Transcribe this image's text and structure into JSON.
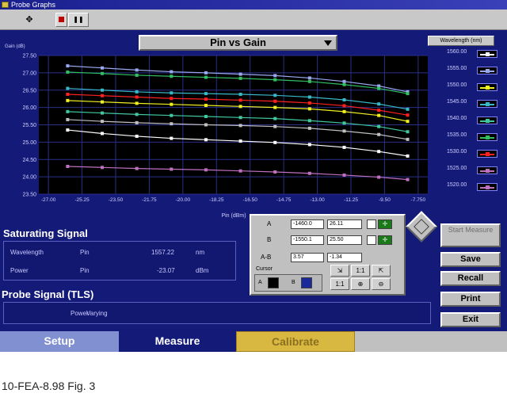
{
  "window": {
    "title": "Probe Graphs"
  },
  "toolbar": {
    "arrow_glyph": "✥",
    "pause_glyph": "❚❚"
  },
  "graph_selector": {
    "selected": "Pin vs Gain"
  },
  "wavelength_button": {
    "label": "Wavelength (nm)"
  },
  "chart_data": {
    "type": "line",
    "ylabel": "Gain (dB)",
    "xlabel": "Pin (dBm)",
    "xlim": [
      -27.5,
      -7.25
    ],
    "ylim": [
      23.5,
      27.5
    ],
    "y_ticks": [
      "27.50",
      "27.00",
      "26.50",
      "26.00",
      "25.50",
      "25.00",
      "24.50",
      "24.00",
      "23.50"
    ],
    "x_ticks": [
      "-27.00",
      "-25.25",
      "-23.50",
      "-21.75",
      "-20.00",
      "-18.25",
      "-16.50",
      "-14.75",
      "-13.00",
      "-11.25",
      "-9.50",
      "-7.750"
    ],
    "x": [
      -26.0,
      -24.2,
      -22.4,
      -20.6,
      -18.8,
      -17.0,
      -15.2,
      -13.4,
      -11.6,
      -9.8,
      -8.3
    ],
    "series": [
      {
        "color": "#9aa8f0",
        "values": [
          27.2,
          27.14,
          27.08,
          27.03,
          27.0,
          26.96,
          26.92,
          26.85,
          26.75,
          26.62,
          26.45
        ]
      },
      {
        "color": "#30c060",
        "values": [
          27.02,
          26.98,
          26.93,
          26.9,
          26.87,
          26.84,
          26.8,
          26.75,
          26.66,
          26.55,
          26.4
        ]
      },
      {
        "color": "#38b8c8",
        "values": [
          26.55,
          26.5,
          26.45,
          26.42,
          26.4,
          26.38,
          26.35,
          26.3,
          26.22,
          26.1,
          25.95
        ]
      },
      {
        "color": "#ff2020",
        "values": [
          26.38,
          26.34,
          26.3,
          26.26,
          26.24,
          26.21,
          26.18,
          26.13,
          26.05,
          25.92,
          25.78
        ]
      },
      {
        "color": "#f0f020",
        "values": [
          26.2,
          26.16,
          26.12,
          26.09,
          26.06,
          26.03,
          26.0,
          25.96,
          25.88,
          25.77,
          25.6
        ]
      },
      {
        "color": "#40c8a0",
        "values": [
          25.88,
          25.84,
          25.8,
          25.77,
          25.74,
          25.71,
          25.68,
          25.62,
          25.55,
          25.45,
          25.3
        ]
      },
      {
        "color": "#c0c0c0",
        "values": [
          25.65,
          25.6,
          25.56,
          25.53,
          25.5,
          25.48,
          25.45,
          25.4,
          25.32,
          25.22,
          25.08
        ]
      },
      {
        "color": "#ffffff",
        "values": [
          25.35,
          25.25,
          25.17,
          25.11,
          25.07,
          25.03,
          24.99,
          24.93,
          24.85,
          24.73,
          24.6
        ]
      },
      {
        "color": "#c070c0",
        "values": [
          24.3,
          24.27,
          24.24,
          24.22,
          24.2,
          24.17,
          24.14,
          24.1,
          24.05,
          23.99,
          23.92
        ]
      }
    ]
  },
  "legend": [
    {
      "label": "1560.00",
      "color": "#ffffff"
    },
    {
      "label": "1555.00",
      "color": "#9aa8f0"
    },
    {
      "label": "1550.00",
      "color": "#f0f020"
    },
    {
      "label": "1545.00",
      "color": "#38b8c8"
    },
    {
      "label": "1540.00",
      "color": "#40c8a0"
    },
    {
      "label": "1535.00",
      "color": "#30c060"
    },
    {
      "label": "1530.00",
      "color": "#ff2020"
    },
    {
      "label": "1525.00",
      "color": "#c070c0"
    },
    {
      "label": "1520.00",
      "color": "#c070c0"
    }
  ],
  "saturating": {
    "title": "Saturating Signal",
    "wavelength_label": "Wavelength",
    "wavelength_sym": "Pin",
    "wavelength_value": "1557.22",
    "wavelength_unit": "nm",
    "power_label": "Power",
    "power_sym": "Pin",
    "power_value": "-23.07",
    "power_unit": "dBm"
  },
  "probe": {
    "title": "Probe Signal (TLS)",
    "power_label": "Power",
    "power_value": "Varying"
  },
  "cursors": {
    "a_label": "A",
    "a_x": "-1460.0",
    "a_y": "26.11",
    "b_label": "B",
    "b_x": "-1550.1",
    "b_y": "25.50",
    "diff_label": "A-B",
    "diff_x": "3.57",
    "diff_y": "-1.34",
    "crosshair_glyph": "✛",
    "cursor_group_label": "Cursor",
    "cursor1_label": "A",
    "cursor2_label": "B"
  },
  "tool_buttons": [
    "⇲",
    "1:1",
    "⇱",
    "1:1",
    "⊕",
    "⊖"
  ],
  "side_buttons": {
    "start_measure": "Start Measure",
    "save": "Save",
    "recall": "Recall",
    "print": "Print",
    "exit": "Exit"
  },
  "tabs": [
    {
      "label": "Setup"
    },
    {
      "label": "Measure"
    },
    {
      "label": "Calibrate"
    }
  ],
  "caption": "10-FEA-8.98 Fig. 3"
}
